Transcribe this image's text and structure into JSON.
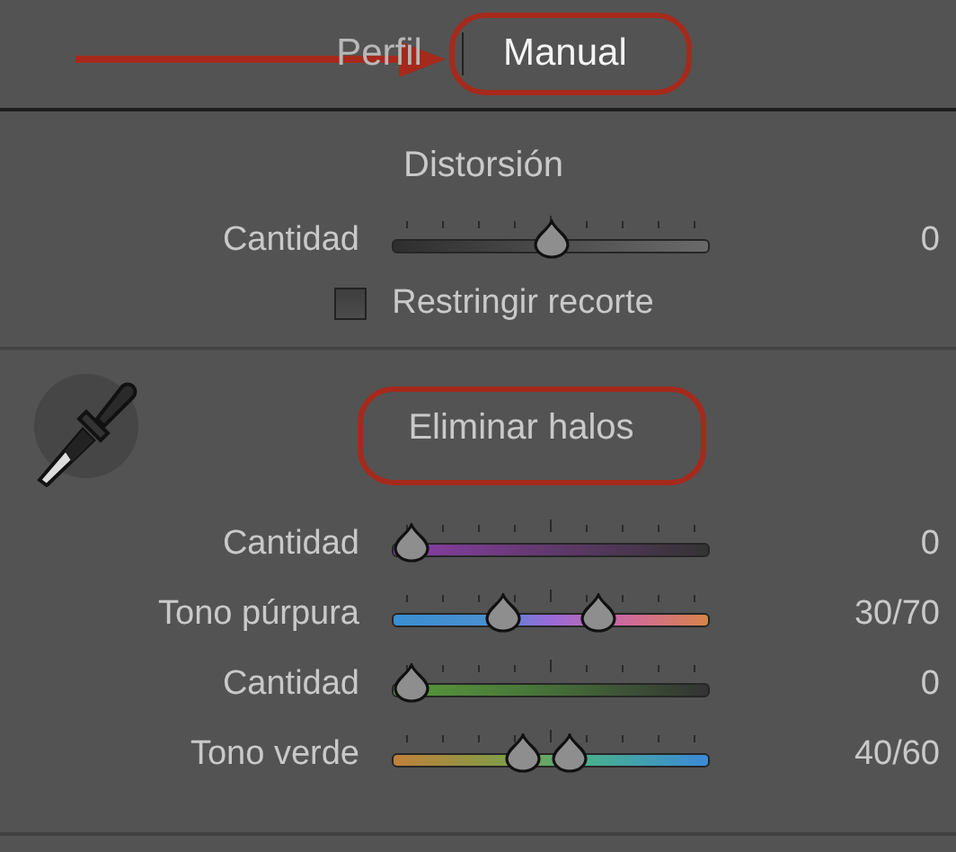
{
  "tabs": [
    {
      "label": "Perfil",
      "selected": false
    },
    {
      "label": "Manual",
      "selected": true
    }
  ],
  "distortion": {
    "title": "Distorsión",
    "sliders": [
      {
        "label": "Cantidad",
        "kind": "neutral",
        "thumbs": [
          {
            "level": 0.5
          }
        ],
        "reading": "0"
      }
    ],
    "checkbox": {
      "label": "Restringir recorte",
      "checked": false
    }
  },
  "defringe": {
    "title": "Eliminar halos",
    "sliders": [
      {
        "label": "Cantidad",
        "kind": "purple",
        "thumbs": [
          {
            "level": 0
          }
        ],
        "reading": "0"
      },
      {
        "label": "Tono púrpura",
        "kind": "purple-hue",
        "thumbs": [
          {
            "level": 0.33
          },
          {
            "level": 0.67
          }
        ],
        "reading": "30/70"
      },
      {
        "label": "Cantidad",
        "kind": "green",
        "thumbs": [
          {
            "level": 0
          }
        ],
        "reading": "0"
      },
      {
        "label": "Tono verde",
        "kind": "green-hue",
        "thumbs": [
          {
            "level": 0.4
          },
          {
            "level": 0.57
          }
        ],
        "reading": "40/60"
      }
    ]
  }
}
